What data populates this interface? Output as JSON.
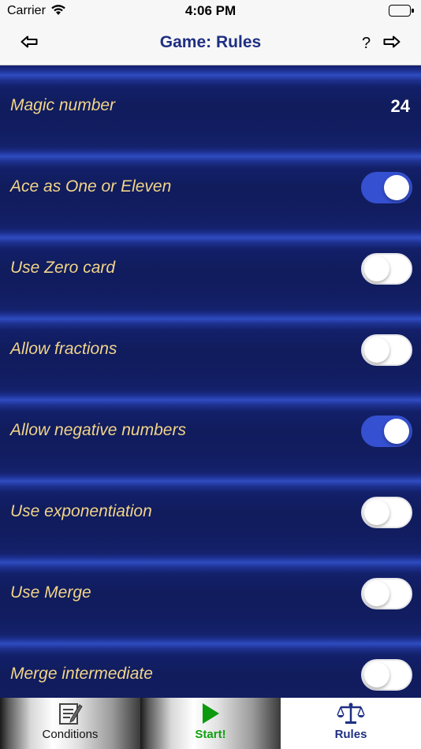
{
  "status_bar": {
    "carrier": "Carrier",
    "time": "4:06 PM",
    "battery_level": 1.0
  },
  "nav": {
    "title": "Game: Rules",
    "back_icon": "arrow-left-icon",
    "help_label": "?",
    "forward_icon": "arrow-right-icon"
  },
  "rules": {
    "magic_number": {
      "label": "Magic number",
      "value": "24"
    },
    "items": [
      {
        "label": "Ace as One or Eleven",
        "on": true
      },
      {
        "label": "Use Zero card",
        "on": false
      },
      {
        "label": "Allow fractions",
        "on": false
      },
      {
        "label": "Allow negative numbers",
        "on": true
      },
      {
        "label": "Use exponentiation",
        "on": false
      },
      {
        "label": "Use Merge",
        "on": false
      },
      {
        "label": "Merge intermediate",
        "on": false
      }
    ]
  },
  "colors": {
    "accent": "#1f2f82",
    "toggle_on": "#3550d0",
    "label_text": "#f2d48a",
    "background": "#101c5c"
  },
  "tab_bar": {
    "tabs": [
      {
        "label": "Conditions",
        "icon": "edit-note-icon",
        "selected": false
      },
      {
        "label": "Start!",
        "icon": "play-icon",
        "selected": false
      },
      {
        "label": "Rules",
        "icon": "scales-icon",
        "selected": true
      }
    ]
  }
}
